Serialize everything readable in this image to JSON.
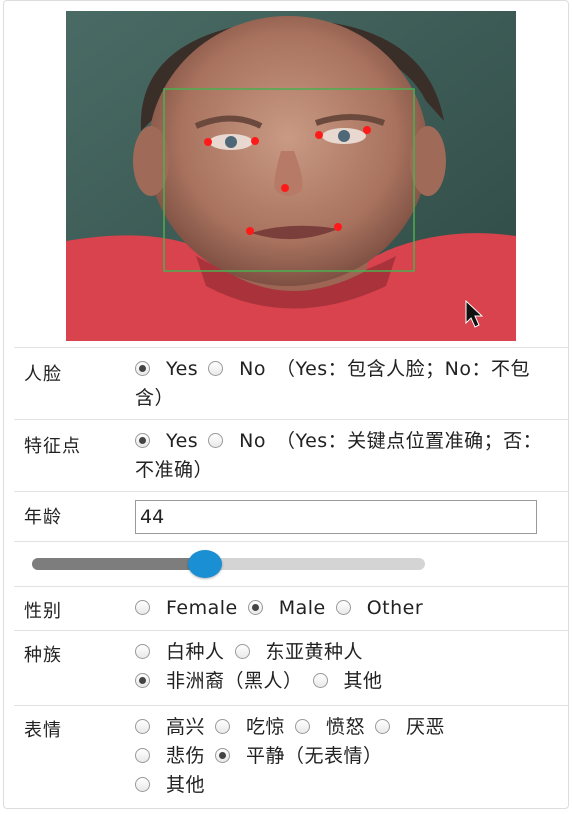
{
  "face": {
    "label": "人脸",
    "yes": "Yes",
    "no": "No",
    "selected": "Yes",
    "note": "（Yes：包含人脸；No：不包含）"
  },
  "landmarks": {
    "label": "特征点",
    "yes": "Yes",
    "no": "No",
    "selected": "Yes",
    "note": "（Yes：关键点位置准确；否：不准确）"
  },
  "age": {
    "label": "年龄",
    "value": "44",
    "slider_fraction": 0.44
  },
  "gender": {
    "label": "性别",
    "options": [
      "Female",
      "Male",
      "Other"
    ],
    "selected": "Male"
  },
  "race": {
    "label": "种族",
    "options": [
      "白种人",
      "东亚黄种人",
      "非洲裔（黑人）",
      "其他"
    ],
    "selected": "非洲裔（黑人）"
  },
  "expression": {
    "label": "表情",
    "options": [
      "高兴",
      "吃惊",
      "愤怒",
      "厌恶",
      "悲伤",
      "平静（无表情）",
      "其他"
    ],
    "selected": "平静（无表情）"
  },
  "colors": {
    "slider_thumb": "#1a8fd3",
    "face_box": "#4caf50",
    "landmark": "#ff1a1a"
  }
}
